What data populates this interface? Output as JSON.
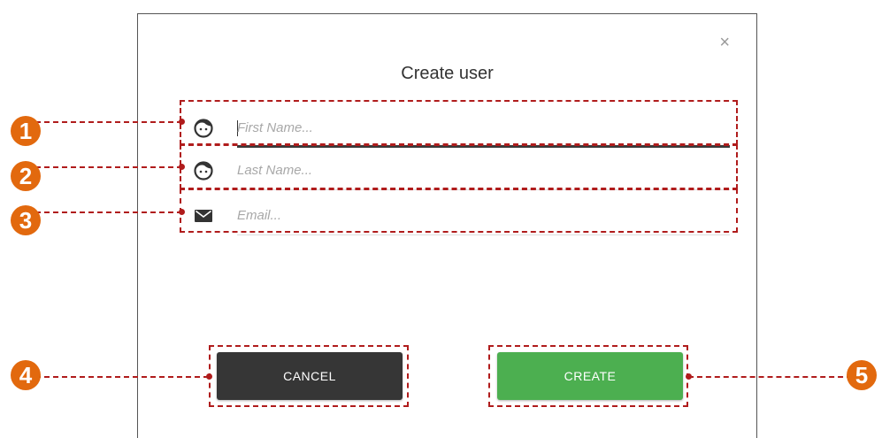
{
  "dialog": {
    "title": "Create user",
    "close_glyph": "×",
    "fields": [
      {
        "icon": "user-face-icon",
        "placeholder": "First Name...",
        "value": ""
      },
      {
        "icon": "user-face-icon",
        "placeholder": "Last Name...",
        "value": ""
      },
      {
        "icon": "envelope-icon",
        "placeholder": "Email...",
        "value": ""
      }
    ],
    "cancel_label": "CANCEL",
    "create_label": "CREATE"
  },
  "callouts": [
    "1",
    "2",
    "3",
    "4",
    "5"
  ],
  "colors": {
    "accent_green": "#4caf50",
    "dark_button": "#363636",
    "callout_orange": "#e2690e",
    "annotation_red": "#b01c1c"
  }
}
